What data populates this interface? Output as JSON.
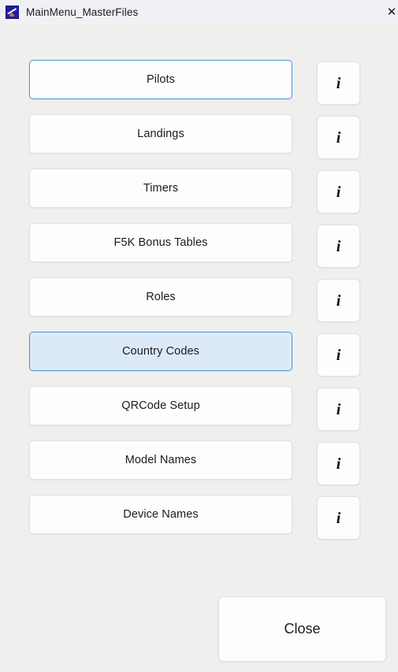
{
  "window": {
    "title": "MainMenu_MasterFiles",
    "icon": "glider-app-icon",
    "close_label": "✕",
    "titlebar_color": "#f1f1f5",
    "body_color": "#efefee",
    "accent_color": "#4a95d8",
    "hover_fill_color": "#dceaf8"
  },
  "menu": {
    "info_glyph": "i",
    "items": [
      {
        "label": "Pilots",
        "state": "focused"
      },
      {
        "label": "Landings",
        "state": "normal"
      },
      {
        "label": "Timers",
        "state": "normal"
      },
      {
        "label": "F5K Bonus Tables",
        "state": "normal"
      },
      {
        "label": "Roles",
        "state": "normal"
      },
      {
        "label": "Country Codes",
        "state": "hovered"
      },
      {
        "label": "QRCode Setup",
        "state": "normal"
      },
      {
        "label": "Model Names",
        "state": "normal"
      },
      {
        "label": "Device Names",
        "state": "normal"
      }
    ]
  },
  "footer": {
    "close_label": "Close"
  }
}
